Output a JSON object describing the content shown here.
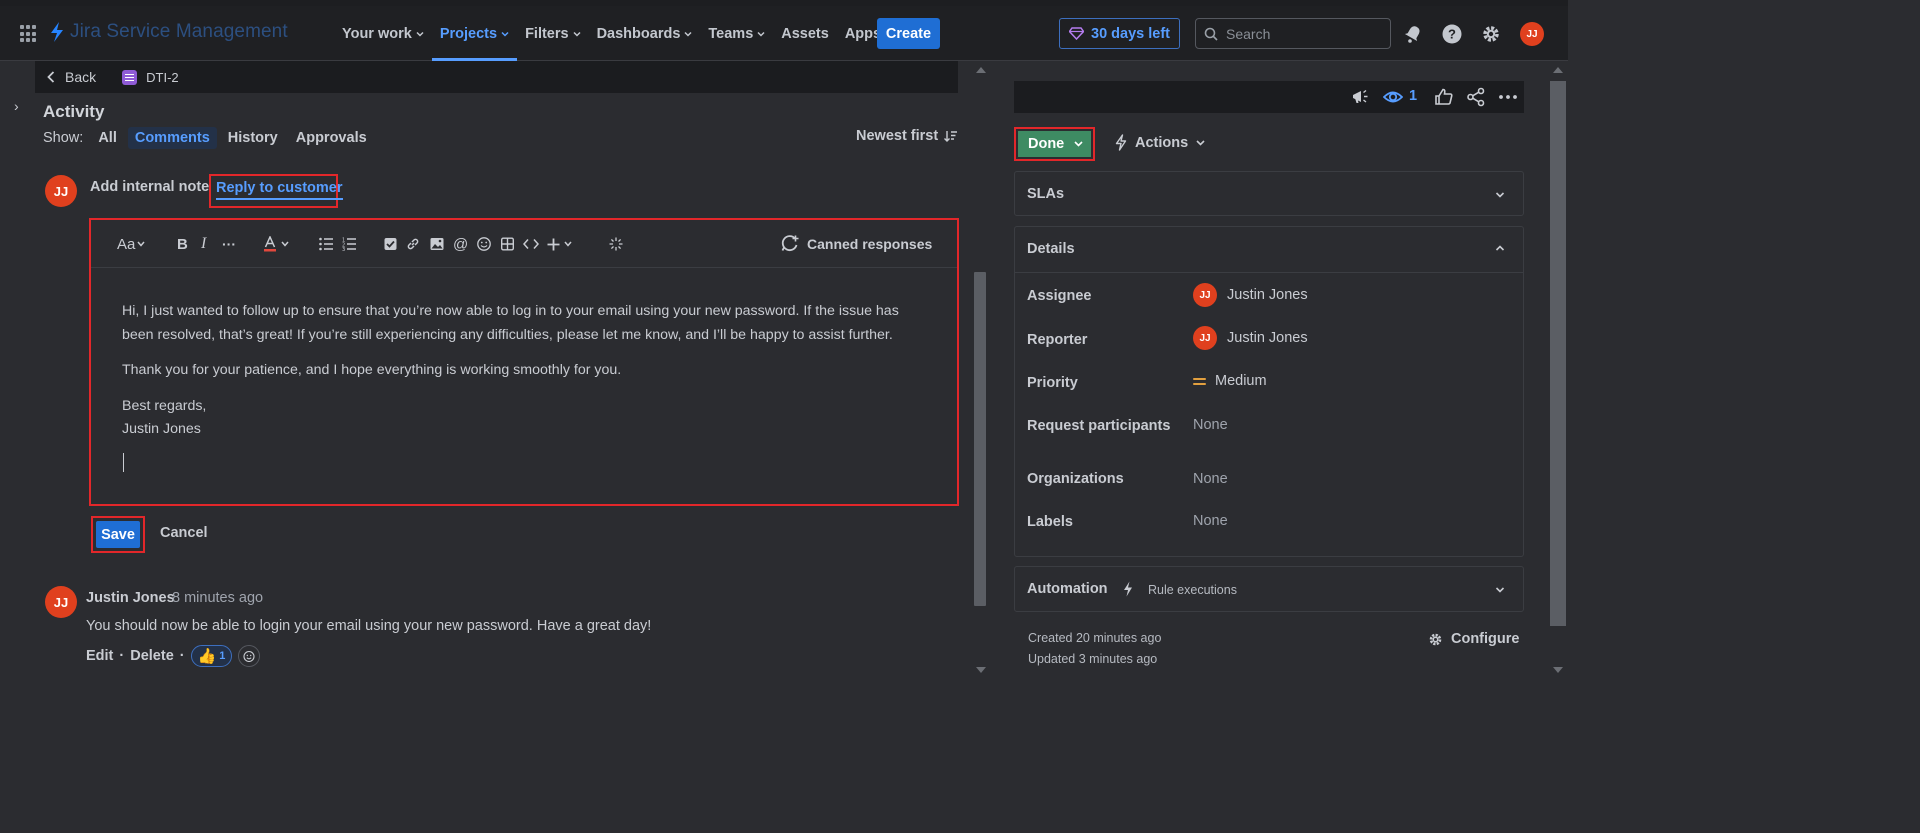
{
  "app": {
    "name": "Jira Service Management",
    "nav": [
      {
        "label": "Your work",
        "dropdown": true,
        "active": false
      },
      {
        "label": "Projects",
        "dropdown": true,
        "active": true
      },
      {
        "label": "Filters",
        "dropdown": true,
        "active": false
      },
      {
        "label": "Dashboards",
        "dropdown": true,
        "active": false
      },
      {
        "label": "Teams",
        "dropdown": true,
        "active": false
      },
      {
        "label": "Assets",
        "dropdown": false,
        "active": false
      },
      {
        "label": "Apps",
        "dropdown": true,
        "active": false
      }
    ],
    "create_label": "Create",
    "trial_label": "30 days left",
    "search_placeholder": "Search",
    "user_initials": "JJ"
  },
  "breadcrumb": {
    "back_label": "Back",
    "issue_key": "DTI-2"
  },
  "activity": {
    "title": "Activity",
    "show_label": "Show:",
    "filters": [
      "All",
      "Comments",
      "History",
      "Approvals"
    ],
    "active_filter": "Comments",
    "sort_label": "Newest first"
  },
  "composer": {
    "avatar_initials": "JJ",
    "tab_internal": "Add internal note",
    "tab_reply": "Reply to customer",
    "toolbar": {
      "text_style": "Aa",
      "canned_label": "Canned responses"
    },
    "body": {
      "p1": "Hi,  I just wanted to follow up to ensure that you’re now able to log in to your email using your new password. If the issue has been resolved, that’s great! If you’re still experiencing any difficulties, please let me know, and I’ll be happy to assist further.",
      "p2": "Thank you for your patience, and I hope everything is working smoothly for you.",
      "p3_line1": "Best regards,",
      "p3_line2": "Justin Jones"
    },
    "save_label": "Save",
    "cancel_label": "Cancel"
  },
  "comment": {
    "avatar_initials": "JJ",
    "author": "Justin Jones",
    "time": "8 minutes ago",
    "body": "You should now be able to login your email using your new password. Have a great day!",
    "edit_label": "Edit",
    "delete_label": "Delete",
    "separator": "·",
    "reaction_emoji": "👍",
    "reaction_count": "1"
  },
  "sidebar": {
    "watch_count": "1",
    "status_label": "Done",
    "actions_label": "Actions",
    "slas_label": "SLAs",
    "details_label": "Details",
    "fields": {
      "assignee_label": "Assignee",
      "assignee_value": "Justin Jones",
      "assignee_initials": "JJ",
      "reporter_label": "Reporter",
      "reporter_value": "Justin Jones",
      "reporter_initials": "JJ",
      "priority_label": "Priority",
      "priority_value": "Medium",
      "participants_label": "Request participants",
      "participants_value": "None",
      "organizations_label": "Organizations",
      "organizations_value": "None",
      "labels_label": "Labels",
      "labels_value": "None"
    },
    "automation_label": "Automation",
    "rule_executions_label": "Rule executions",
    "created": "Created 20 minutes ago",
    "updated": "Updated 3 minutes ago",
    "configure_label": "Configure"
  },
  "colors": {
    "accent": "#579dff",
    "primary_button": "#1f6ed4",
    "status_done": "#3e8b63",
    "highlight_box": "#e2272a",
    "avatar": "#e0401e"
  }
}
